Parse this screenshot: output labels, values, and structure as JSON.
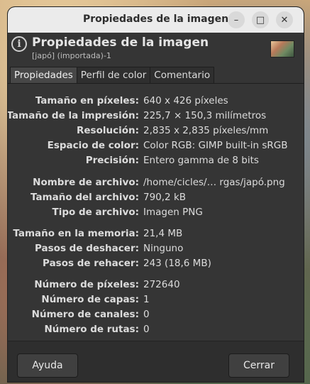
{
  "window": {
    "title": "Propiedades de la imagen",
    "minimize_icon": "–",
    "maximize_icon": "□",
    "close_icon": "✕"
  },
  "header": {
    "title": "Propiedades de la imagen",
    "subtitle": "[japó] (importada)-1",
    "info_icon": "i"
  },
  "tabs": [
    {
      "label": "Propiedades"
    },
    {
      "label": "Perfil de color"
    },
    {
      "label": "Comentario"
    }
  ],
  "properties": [
    {
      "label": "Tamaño en píxeles:",
      "value": "640 x 426 píxeles"
    },
    {
      "label": "Tamaño de la impresión:",
      "value": "225,7 × 150,3 milímetros"
    },
    {
      "label": "Resolución:",
      "value": "2,835 x 2,835 píxeles/mm"
    },
    {
      "label": "Espacio de color:",
      "value": "Color RGB: GIMP built-in sRGB"
    },
    {
      "label": "Precisión:",
      "value": "Entero gamma de 8 bits"
    },
    {
      "label": "Nombre de archivo:",
      "value": "/home/cicles/… rgas/japó.png"
    },
    {
      "label": "Tamaño del archivo:",
      "value": "790,2 kB"
    },
    {
      "label": "Tipo de archivo:",
      "value": "Imagen PNG"
    },
    {
      "label": "Tamaño en la memoria:",
      "value": "21,4 MB"
    },
    {
      "label": "Pasos de deshacer:",
      "value": "Ninguno"
    },
    {
      "label": "Pasos de rehacer:",
      "value": "243 (18,6 MB)"
    },
    {
      "label": "Número de píxeles:",
      "value": "272640"
    },
    {
      "label": "Número de capas:",
      "value": "1"
    },
    {
      "label": "Número de canales:",
      "value": "0"
    },
    {
      "label": "Número de rutas:",
      "value": "0"
    }
  ],
  "footer": {
    "help_label": "Ayuda",
    "close_label": "Cerrar"
  }
}
